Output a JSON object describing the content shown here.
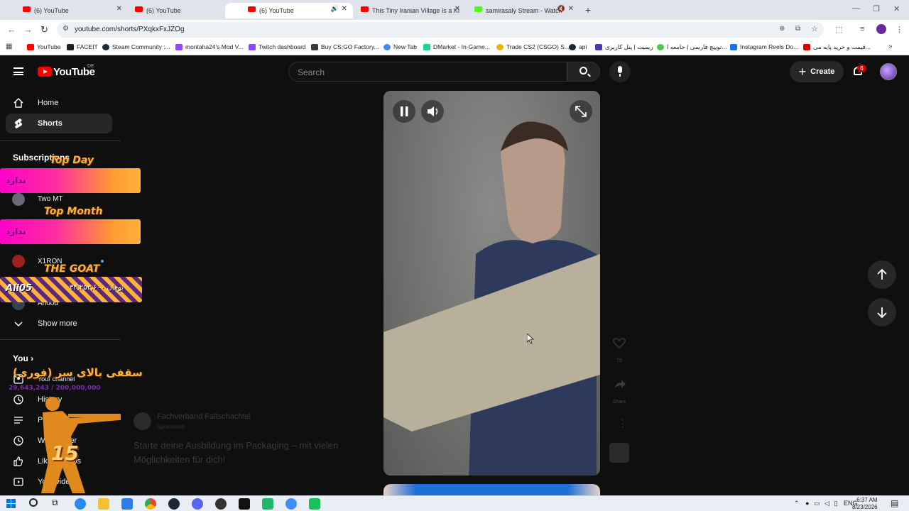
{
  "browser": {
    "tabs": [
      {
        "title": "(6) YouTube"
      },
      {
        "title": "(6) YouTube"
      },
      {
        "title": "(6) YouTube"
      },
      {
        "title": "This Tiny Iranian Village Is a Ki"
      },
      {
        "title": "samirasaly Stream - Watch"
      }
    ],
    "new_tab": "+",
    "url": "youtube.com/shorts/PXqkxFxJZOg",
    "bookmarks": [
      {
        "label": "YouTube",
        "color": "#ff0000"
      },
      {
        "label": "FACEIT",
        "color": "#222222"
      },
      {
        "label": "Steam Community :...",
        "color": "#1b2838"
      },
      {
        "label": "montaha24's Mod V...",
        "color": "#9146ff"
      },
      {
        "label": "Twitch dashboard",
        "color": "#9146ff"
      },
      {
        "label": "Buy CS:GO Factory...",
        "color": "#3a3a3a"
      },
      {
        "label": "New Tab",
        "color": "#4285f4"
      },
      {
        "label": "DMarket - In-Game...",
        "color": "#1ad28f"
      },
      {
        "label": "Trade CS2 (CSGO) S...",
        "color": "#f0b400"
      },
      {
        "label": "api",
        "color": "#1b2838"
      },
      {
        "label": "ریمیت | پنل کاربری",
        "color": "#4a3aa8"
      },
      {
        "label": "توییچ فارسی | جامعه ا...",
        "color": "#53c24b"
      },
      {
        "label": "Instagram Reels Do...",
        "color": "#1a73e8"
      },
      {
        "label": "قیمت و خرید پایه می...",
        "color": "#d30000"
      }
    ]
  },
  "youtube": {
    "logo_text": "YouTube",
    "country": "DE",
    "search_placeholder": "Search",
    "create_label": "Create",
    "notification_count": "6"
  },
  "sidebar": {
    "home": "Home",
    "shorts": "Shorts",
    "subscriptions": "Subscriptions",
    "channels": [
      "Two MT",
      "X1RON",
      "Ahood"
    ],
    "show_more": "Show more",
    "you": "You",
    "you_items": [
      "Your channel",
      "History",
      "Playlists",
      "Watch later",
      "Liked videos",
      "Your videos"
    ]
  },
  "overlay": {
    "top_day": "Top Day",
    "top_day_value": "ندارد",
    "top_month": "Top Month",
    "top_month_value": "ندارد",
    "the_goat": "THE GOAT",
    "goat_name": "Ali05",
    "goat_amount": "۳۳,۲۵۳,۶۰۰ تومان",
    "goal_text": "سقفی بالای سر (فوری)",
    "goal_progress": "29,643,243 / 200,000,000",
    "soldier_number": "15"
  },
  "shorts_actions": {
    "like_count": "79",
    "share": "Share"
  },
  "ad": {
    "advertiser": "Fachverband Faltschachtel",
    "sponsored": "Sponsored",
    "headline": "Starte deine Ausbildung im Packaging – mit vielen Möglichkeiten für dich!"
  },
  "taskbar": {
    "lang": "ENG",
    "time": "6:37 AM",
    "date": "8/23/2026"
  }
}
